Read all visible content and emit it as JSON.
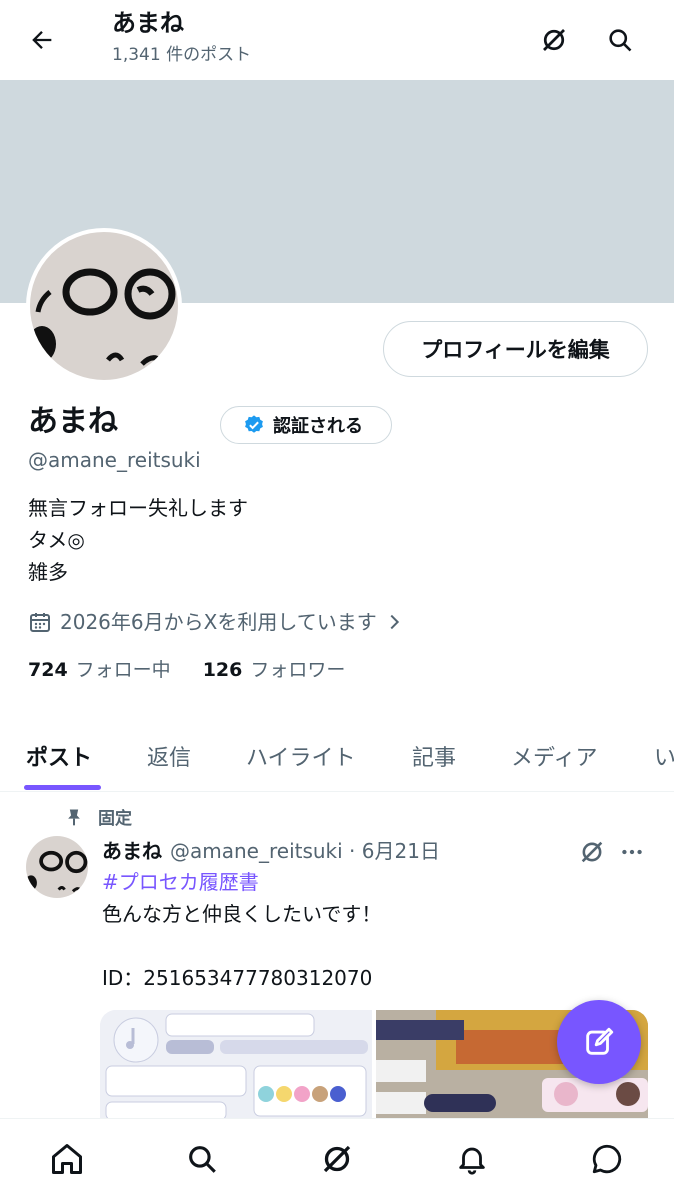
{
  "header": {
    "title": "あまね",
    "post_count": "1,341 件のポスト"
  },
  "profile": {
    "edit_label": "プロフィールを編集",
    "name": "あまね",
    "verify_label": "認証される",
    "handle": "@amane_reitsuki",
    "bio": [
      "無言フォロー失礼します",
      "タメ◎",
      "雑多"
    ],
    "joined": "2026年6月からXを利用しています",
    "following_count": "724",
    "following_label": "フォロー中",
    "followers_count": "126",
    "followers_label": "フォロワー"
  },
  "tabs": [
    {
      "label": "ポスト",
      "active": true
    },
    {
      "label": "返信"
    },
    {
      "label": "ハイライト"
    },
    {
      "label": "記事"
    },
    {
      "label": "メディア"
    },
    {
      "label": "い"
    }
  ],
  "post": {
    "pinned_label": "固定",
    "author_name": "あまね",
    "author_meta": "@amane_reitsuki · 6月21日",
    "hashtag": "#プロセカ履歴書",
    "line1": "色んな方と仲良くしたいです！",
    "line2": "ID：251653477780312070"
  },
  "colors": {
    "accent": "#7856ff",
    "banner": "#cfd9de",
    "verified": "#1d9bf0",
    "secondary_text": "#536471"
  },
  "icons": {
    "back": "arrow-left-icon",
    "grok": "grok-icon",
    "search": "search-icon",
    "calendar": "calendar-icon",
    "pin": "pin-icon",
    "compose": "compose-icon",
    "home": "home-icon",
    "notifications": "bell-icon",
    "messages": "chat-icon"
  }
}
